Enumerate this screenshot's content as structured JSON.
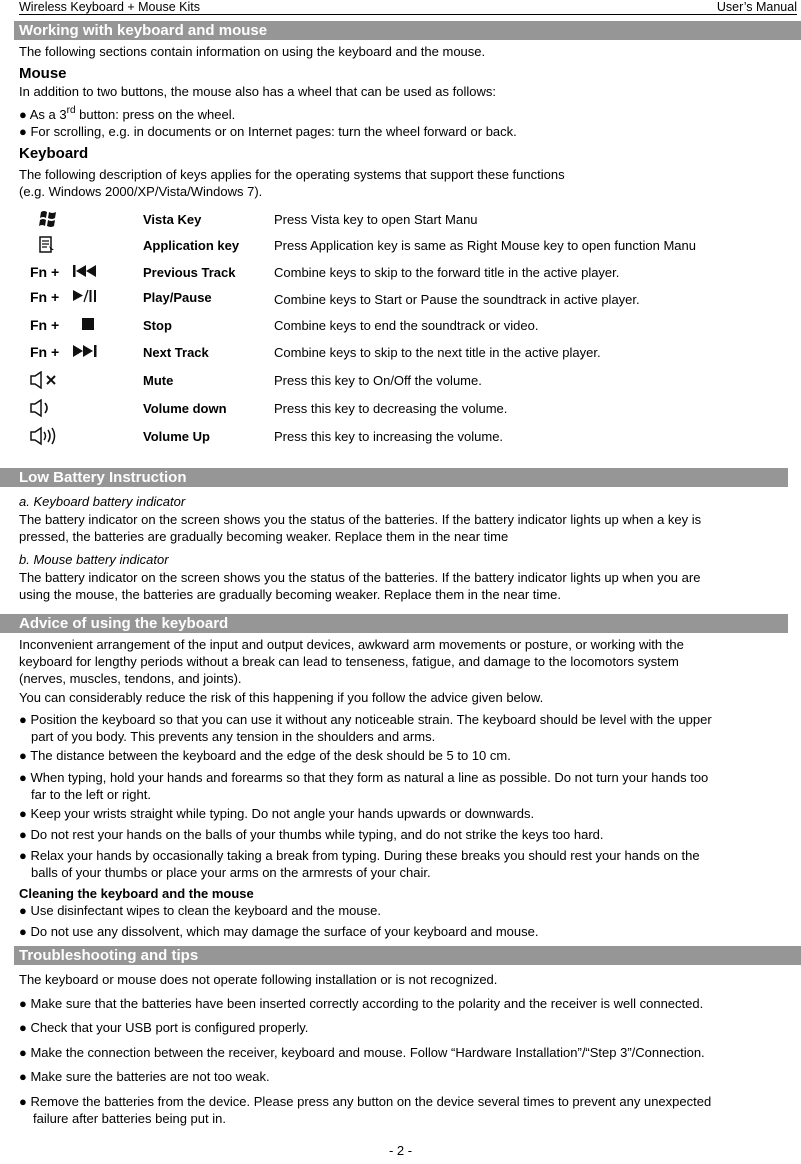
{
  "header": {
    "left": "Wireless Keyboard + Mouse Kits",
    "right": "User’s Manual"
  },
  "sections": {
    "working": {
      "title": "Working with keyboard and mouse",
      "intro": "The following sections contain information on using the keyboard and the mouse.",
      "mouse_heading": "Mouse",
      "mouse_intro": "In addition to two buttons, the mouse also has a wheel that can be used as follows:",
      "mouse_bullet1_pre": "● As a 3",
      "mouse_bullet1_sup": "rd",
      "mouse_bullet1_post": " button: press on the wheel.",
      "mouse_bullet2": "● For scrolling, e.g. in documents or on Internet pages: turn the wheel forward or back.",
      "keyboard_heading": "Keyboard",
      "keyboard_intro1": "The following description of keys applies for the operating systems that support these functions",
      "keyboard_intro2": "(e.g. Windows 2000/XP/Vista/Windows 7)."
    },
    "keys": [
      {
        "icon": "windows-logo-icon",
        "fn": "",
        "glyph": "",
        "name": "Vista Key",
        "desc": "Press Vista key to open Start Manu"
      },
      {
        "icon": "application-menu-icon",
        "fn": "",
        "glyph": "",
        "name": "Application key",
        "desc": "Press Application key is same as Right Mouse key to open function Manu"
      },
      {
        "icon": "previous-track-icon",
        "fn": "Fn +",
        "glyph": "⏮",
        "name": "Previous Track",
        "desc": "Combine keys to skip to the forward title in the active player."
      },
      {
        "icon": "play-pause-icon",
        "fn": "Fn +",
        "glyph": "▶/II",
        "name": "Play/Pause",
        "desc": "Combine keys to Start or Pause the soundtrack in active player."
      },
      {
        "icon": "stop-icon",
        "fn": "Fn +",
        "glyph": "■",
        "name": "Stop",
        "desc": "Combine keys to end the soundtrack or video."
      },
      {
        "icon": "next-track-icon",
        "fn": "Fn +",
        "glyph": "⏭",
        "name": "Next Track",
        "desc": "Combine keys to skip to the next title in the active player."
      },
      {
        "icon": "mute-icon",
        "fn": "",
        "glyph": "✕",
        "name": "Mute",
        "desc": "Press this key to On/Off the volume."
      },
      {
        "icon": "volume-down-icon",
        "fn": "",
        "glyph": ")",
        "name": "Volume down",
        "desc": "Press this key to decreasing the volume."
      },
      {
        "icon": "volume-up-icon",
        "fn": "",
        "glyph": ")))",
        "name": "Volume Up",
        "desc": "Press this key to increasing the volume."
      }
    ],
    "battery": {
      "title": "Low Battery Instruction",
      "a_heading": "a. Keyboard battery indicator",
      "a_line1": "The battery indicator on the screen shows you the status of the batteries. If the battery indicator lights up when a key is",
      "a_line2": "pressed, the batteries are gradually becoming weaker. Replace them in the near time",
      "b_heading": "b. Mouse battery indicator",
      "b_line1": "The battery indicator on the screen shows you the status of the batteries. If the battery indicator lights up when you are",
      "b_line2": "using the mouse, the batteries are gradually becoming weaker. Replace them in the near time."
    },
    "advice": {
      "title": "Advice of using the keyboard",
      "p1_l1": "Inconvenient arrangement of the input and output devices, awkward arm movements or posture, or working with the",
      "p1_l2": "keyboard for lengthy periods without a break can lead to tenseness, fatigue, and damage to the locomotors system",
      "p1_l3": "(nerves, muscles, tendons, and joints).",
      "p2": "You can considerably reduce the risk of this happening if you follow the advice given below.",
      "b1_l1": "● Position the keyboard so that you can use it without any noticeable strain. The keyboard should be level with the upper",
      "b1_l2": "part of you body. This prevents any tension in the shoulders and arms.",
      "b2": "● The distance between the keyboard and the edge of the desk should be 5 to 10 cm.",
      "b3_l1": "● When typing, hold your hands and forearms so that they form as natural a line as possible. Do not turn your hands too",
      "b3_l2": "far to the left or right.",
      "b4": "● Keep your wrists straight while typing. Do not angle your hands upwards or downwards.",
      "b5": "● Do not rest your hands on the balls of your thumbs while typing, and do not strike the keys too hard.",
      "b6_l1": "● Relax your hands by occasionally taking a break from typing. During these breaks you should rest your hands on the",
      "b6_l2": "balls of your thumbs or place your arms on the armrests of your chair.",
      "cleaning_heading": "Cleaning the keyboard and the mouse",
      "c1": "● Use disinfectant wipes to clean the keyboard and the mouse.",
      "c2": "● Do not use any dissolvent, which may damage the surface of your keyboard and mouse."
    },
    "trouble": {
      "title": "Troubleshooting and tips",
      "intro": "The keyboard or mouse does not operate following installation or is not recognized.",
      "t1": "● Make sure that the batteries have been inserted correctly according to the polarity and the receiver is well connected.",
      "t2": "● Check that your USB port is configured properly.",
      "t3": "● Make the connection between the receiver, keyboard and mouse. Follow “Hardware Installation”/“Step 3”/Connection.",
      "t4": "● Make sure the batteries are not too weak.",
      "t5_l1": "● Remove the batteries from the device. Please press any button on the device several times to prevent any unexpected",
      "t5_l2": "failure after batteries being put in."
    }
  },
  "page_number": "- 2 -"
}
